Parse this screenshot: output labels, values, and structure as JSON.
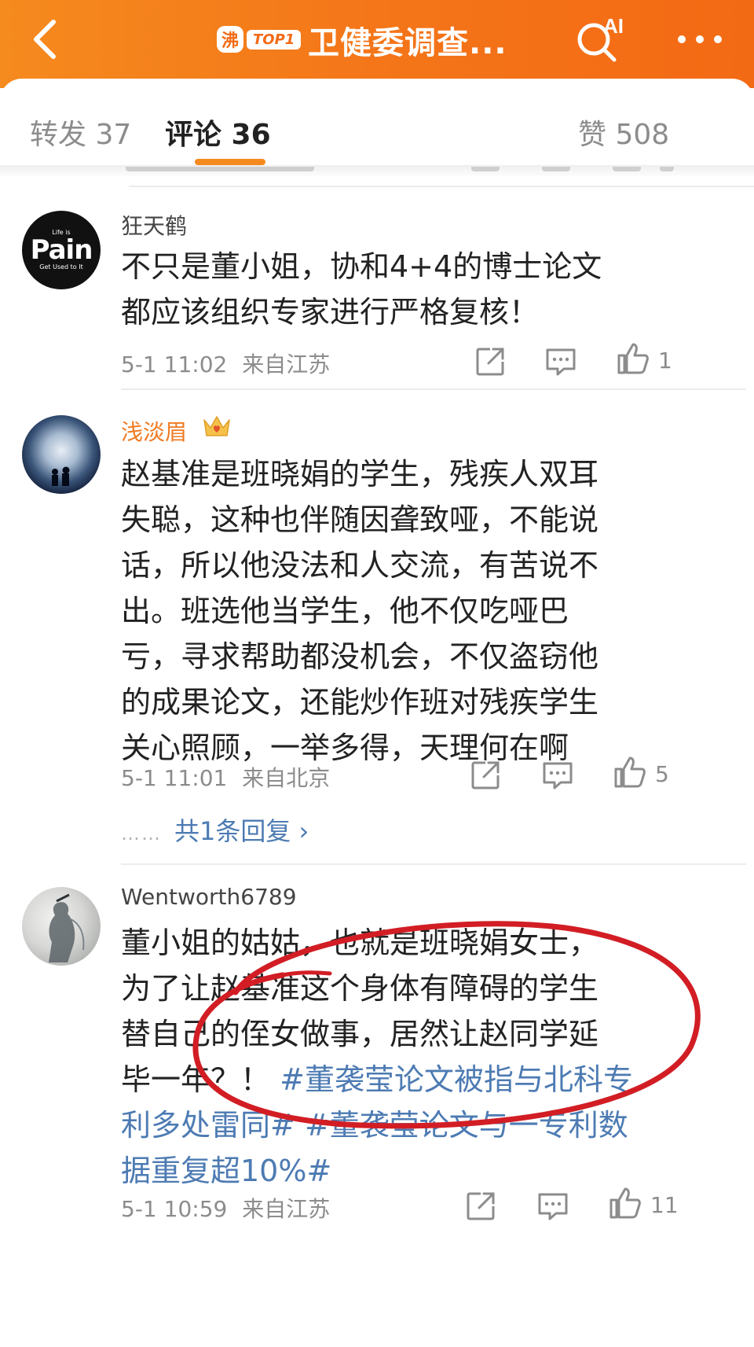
{
  "header": {
    "hot_badge": "沸",
    "hot_rank": "TOP1",
    "title": "卫健委调查...",
    "colors": {
      "bar": "#f47418",
      "accent": "#f58a1e",
      "link": "#4d7bb3"
    }
  },
  "tabs": [
    {
      "label": "转发 37"
    },
    {
      "label": "评论 36"
    },
    {
      "label": "赞 508"
    }
  ],
  "comments": [
    {
      "username": "狂天鹤",
      "avatar_text": {
        "top": "Life is",
        "main": "Pain",
        "bottom": "Get Used to It"
      },
      "lines": [
        "不只是董小姐，协和4+4的博士论文",
        "都应该组织专家进行严格复核！"
      ],
      "time": "5-1 11:02",
      "location": "来自江苏",
      "likes": "1"
    },
    {
      "username": "浅淡眉",
      "badge": "crown",
      "lines": [
        "赵基准是班晓娟的学生，残疾人双耳",
        "失聪，这种也伴随因聋致哑，不能说",
        "话，所以他没法和人交流，有苦说不",
        "出。班选他当学生，他不仅吃哑巴",
        "亏，寻求帮助都没机会，不仅盗窃他",
        "的成果论文，还能炒作班对残疾学生",
        "关心照顾，一举多得，天理何在啊"
      ],
      "time": "5-1 11:01",
      "location": "来自北京",
      "likes": "5",
      "replies": "共1条回复 ›",
      "replies_dots": "……"
    },
    {
      "username": "Wentworth6789",
      "text_plain_lines": [
        "董小姐的姑姑，也就是班晓娟女士，",
        "为了让赵基准这个身体有障碍的学生",
        "替自己的侄女做事，居然让赵同学延",
        "毕一年？！"
      ],
      "hashtag_1": "#董袭莹论文被指与北科专",
      "hashtag_1b": "利多处雷同#",
      "hashtag_2a": "#董袭莹论文与一专利数",
      "hashtag_2b": "据重复超10%#",
      "time": "5-1 10:59",
      "location": "来自江苏",
      "likes": "11"
    }
  ]
}
